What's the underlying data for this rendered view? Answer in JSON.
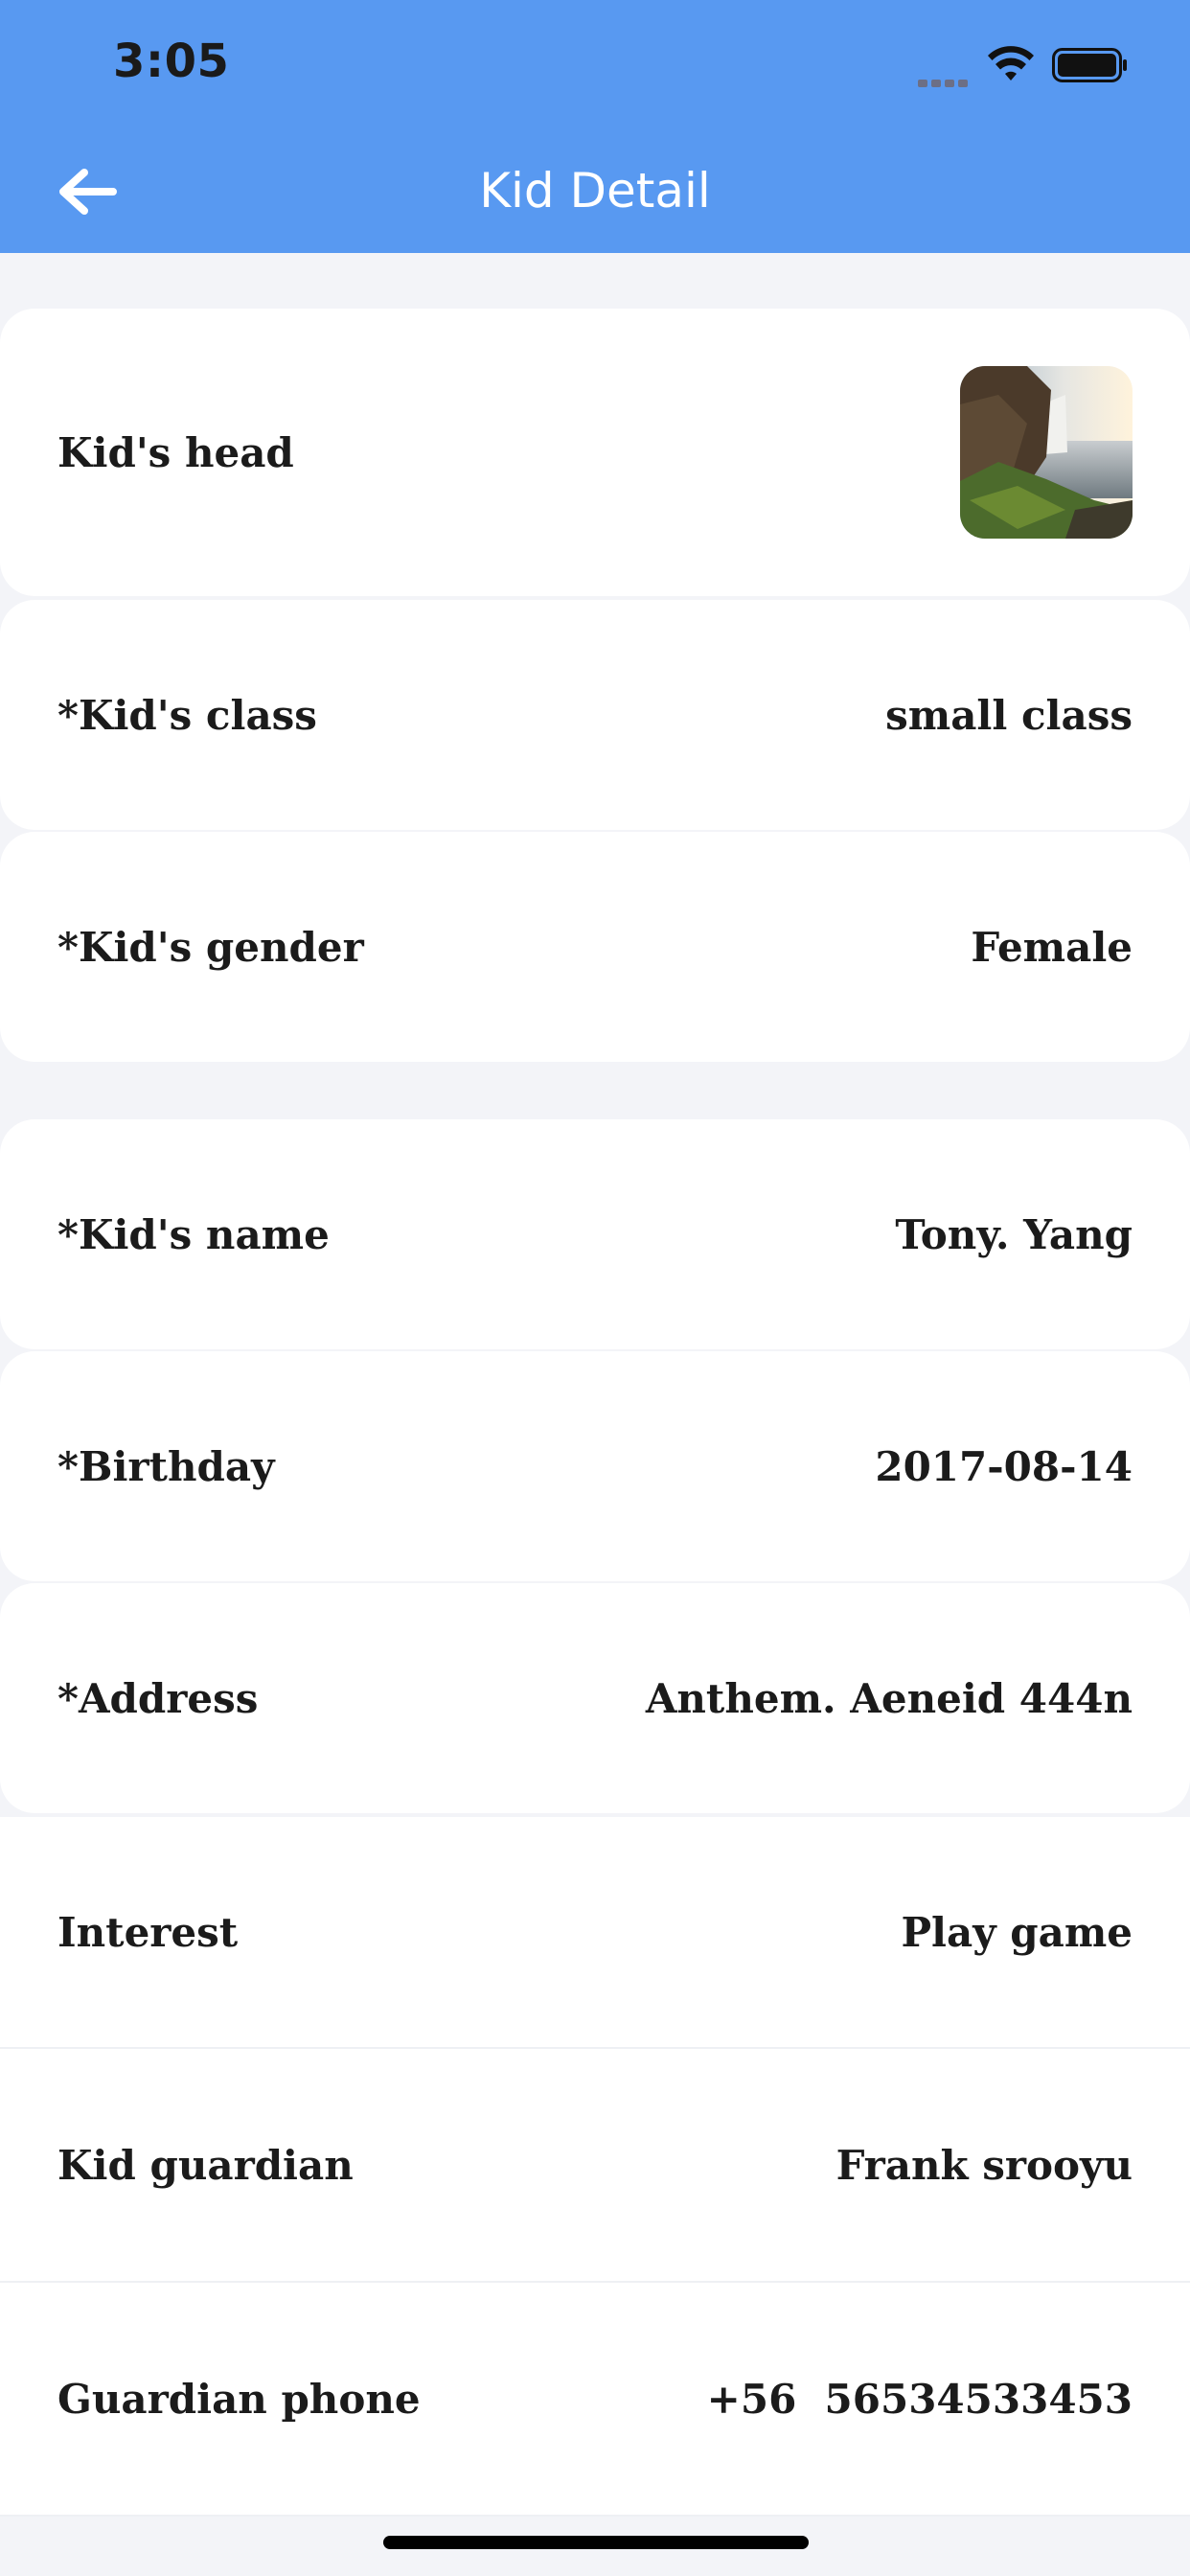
{
  "status_bar": {
    "time": "3:05",
    "icons": [
      "signal-icon",
      "wifi-icon",
      "battery-icon"
    ]
  },
  "header": {
    "title": "Kid Detail",
    "back_icon": "arrow-left-icon",
    "background_color": "#5899f1"
  },
  "rows": {
    "head": {
      "label": "Kid's head",
      "value_type": "image"
    },
    "class": {
      "label": "*Kid's class",
      "value": "small class"
    },
    "gender": {
      "label": "*Kid's gender",
      "value": "Female"
    },
    "name": {
      "label": "*Kid's name",
      "value": "Tony. Yang"
    },
    "birthday": {
      "label": "*Birthday",
      "value": "2017-08-14"
    },
    "address": {
      "label": "*Address",
      "value": "Anthem. Aeneid 444n"
    },
    "interest": {
      "label": "Interest",
      "value": "Play game"
    },
    "guardian": {
      "label": "Kid guardian",
      "value": "Frank srooyu"
    },
    "phone": {
      "label": "Guardian phone",
      "value": "+56  56534533453"
    }
  }
}
